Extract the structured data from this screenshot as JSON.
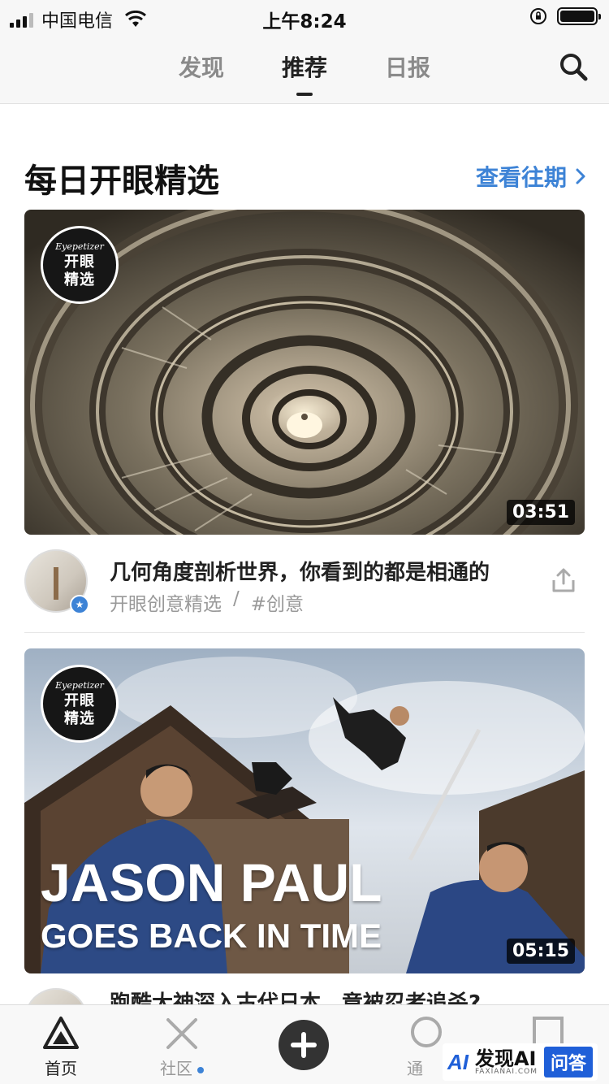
{
  "status_bar": {
    "carrier": "中国电信",
    "time": "上午8:24"
  },
  "nav": {
    "tabs": [
      {
        "label": "发现",
        "active": false
      },
      {
        "label": "推荐",
        "active": true
      },
      {
        "label": "日报",
        "active": false
      }
    ],
    "search_icon": "search-icon"
  },
  "section": {
    "title": "每日开眼精选",
    "history_label": "查看往期"
  },
  "badge": {
    "brand": "Eyepetizer",
    "line1": "开眼",
    "line2": "精选"
  },
  "videos": [
    {
      "title": "几何角度剖析世界，你看到的都是相通的",
      "author": "开眼创意精选",
      "separator": "/",
      "tag": "#创意",
      "duration": "03:51"
    },
    {
      "title": "跑酷大神深入古代日本，竟被忍者追杀?",
      "cover_line1": "JASON PAUL",
      "cover_line2": "GOES BACK IN TIME",
      "duration": "05:15"
    }
  ],
  "tabbar": {
    "items": [
      {
        "label": "首页",
        "icon": "home-triangle-icon",
        "active": true
      },
      {
        "label": "社区",
        "icon": "community-x-icon",
        "active": false,
        "has_dot": true
      },
      {
        "label": "",
        "icon": "publish-plus-icon"
      },
      {
        "label": "通",
        "icon": "notification-circle-icon",
        "active": false
      },
      {
        "label": "",
        "icon": "profile-square-icon",
        "active": false
      }
    ]
  },
  "watermark": {
    "name": "发现AI",
    "domain": "FAXIANAI.COM",
    "tag": "问答"
  },
  "colors": {
    "accent": "#3d83d6",
    "text": "#222222",
    "muted": "#999999"
  }
}
